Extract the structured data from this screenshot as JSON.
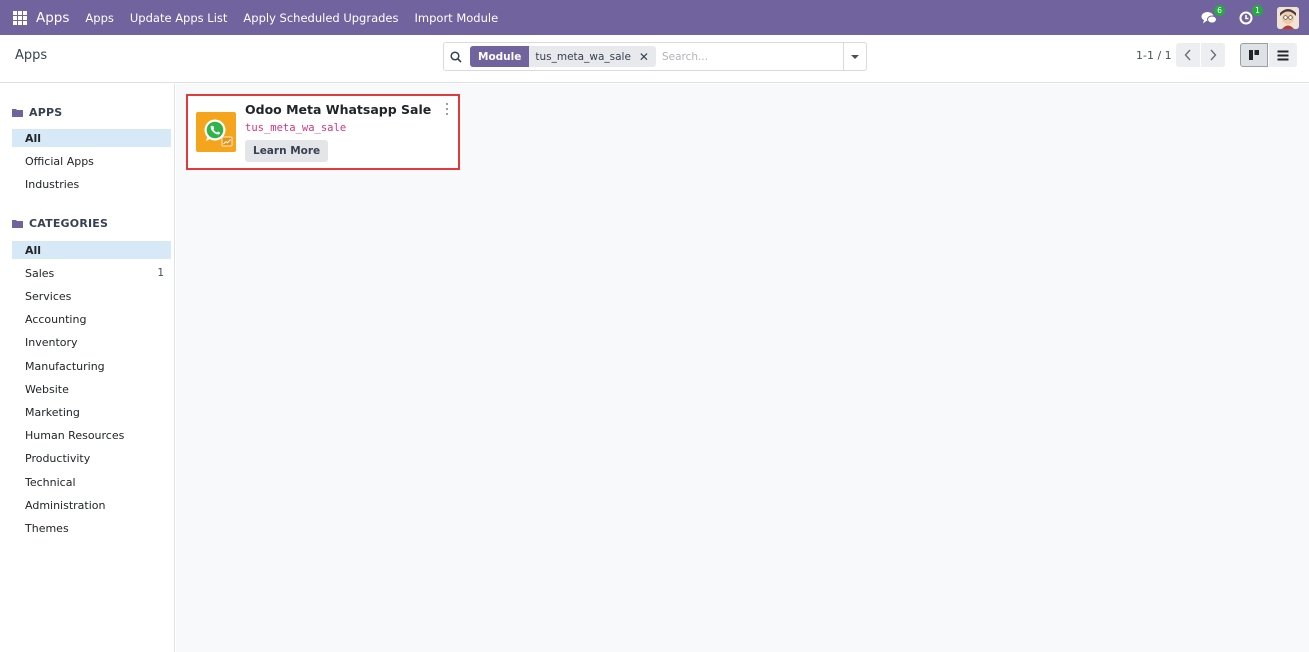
{
  "navbar": {
    "brand": "Apps",
    "menu": [
      "Apps",
      "Update Apps List",
      "Apply Scheduled Upgrades",
      "Import Module"
    ],
    "messages_count": "6",
    "activities_count": "1",
    "color": "#71639e"
  },
  "control_panel": {
    "breadcrumb": "Apps",
    "search": {
      "facet_label": "Module",
      "facet_value": "tus_meta_wa_sale",
      "placeholder": "Search..."
    },
    "pager": "1-1 / 1"
  },
  "sidebar": {
    "apps_section": {
      "title": "APPS",
      "items": [
        {
          "label": "All",
          "active": true
        },
        {
          "label": "Official Apps",
          "active": false
        },
        {
          "label": "Industries",
          "active": false
        }
      ]
    },
    "categories_section": {
      "title": "CATEGORIES",
      "items": [
        {
          "label": "All",
          "count": "",
          "active": true
        },
        {
          "label": "Sales",
          "count": "1",
          "active": false
        },
        {
          "label": "Services",
          "count": "",
          "active": false
        },
        {
          "label": "Accounting",
          "count": "",
          "active": false
        },
        {
          "label": "Inventory",
          "count": "",
          "active": false
        },
        {
          "label": "Manufacturing",
          "count": "",
          "active": false
        },
        {
          "label": "Website",
          "count": "",
          "active": false
        },
        {
          "label": "Marketing",
          "count": "",
          "active": false
        },
        {
          "label": "Human Resources",
          "count": "",
          "active": false
        },
        {
          "label": "Productivity",
          "count": "",
          "active": false
        },
        {
          "label": "Technical",
          "count": "",
          "active": false
        },
        {
          "label": "Administration",
          "count": "",
          "active": false
        },
        {
          "label": "Themes",
          "count": "",
          "active": false
        }
      ]
    }
  },
  "cards": [
    {
      "name": "Odoo Meta Whatsapp Sale",
      "technical_name": "tus_meta_wa_sale",
      "button_label": "Learn More",
      "icon": "whatsapp-sale-icon"
    }
  ]
}
